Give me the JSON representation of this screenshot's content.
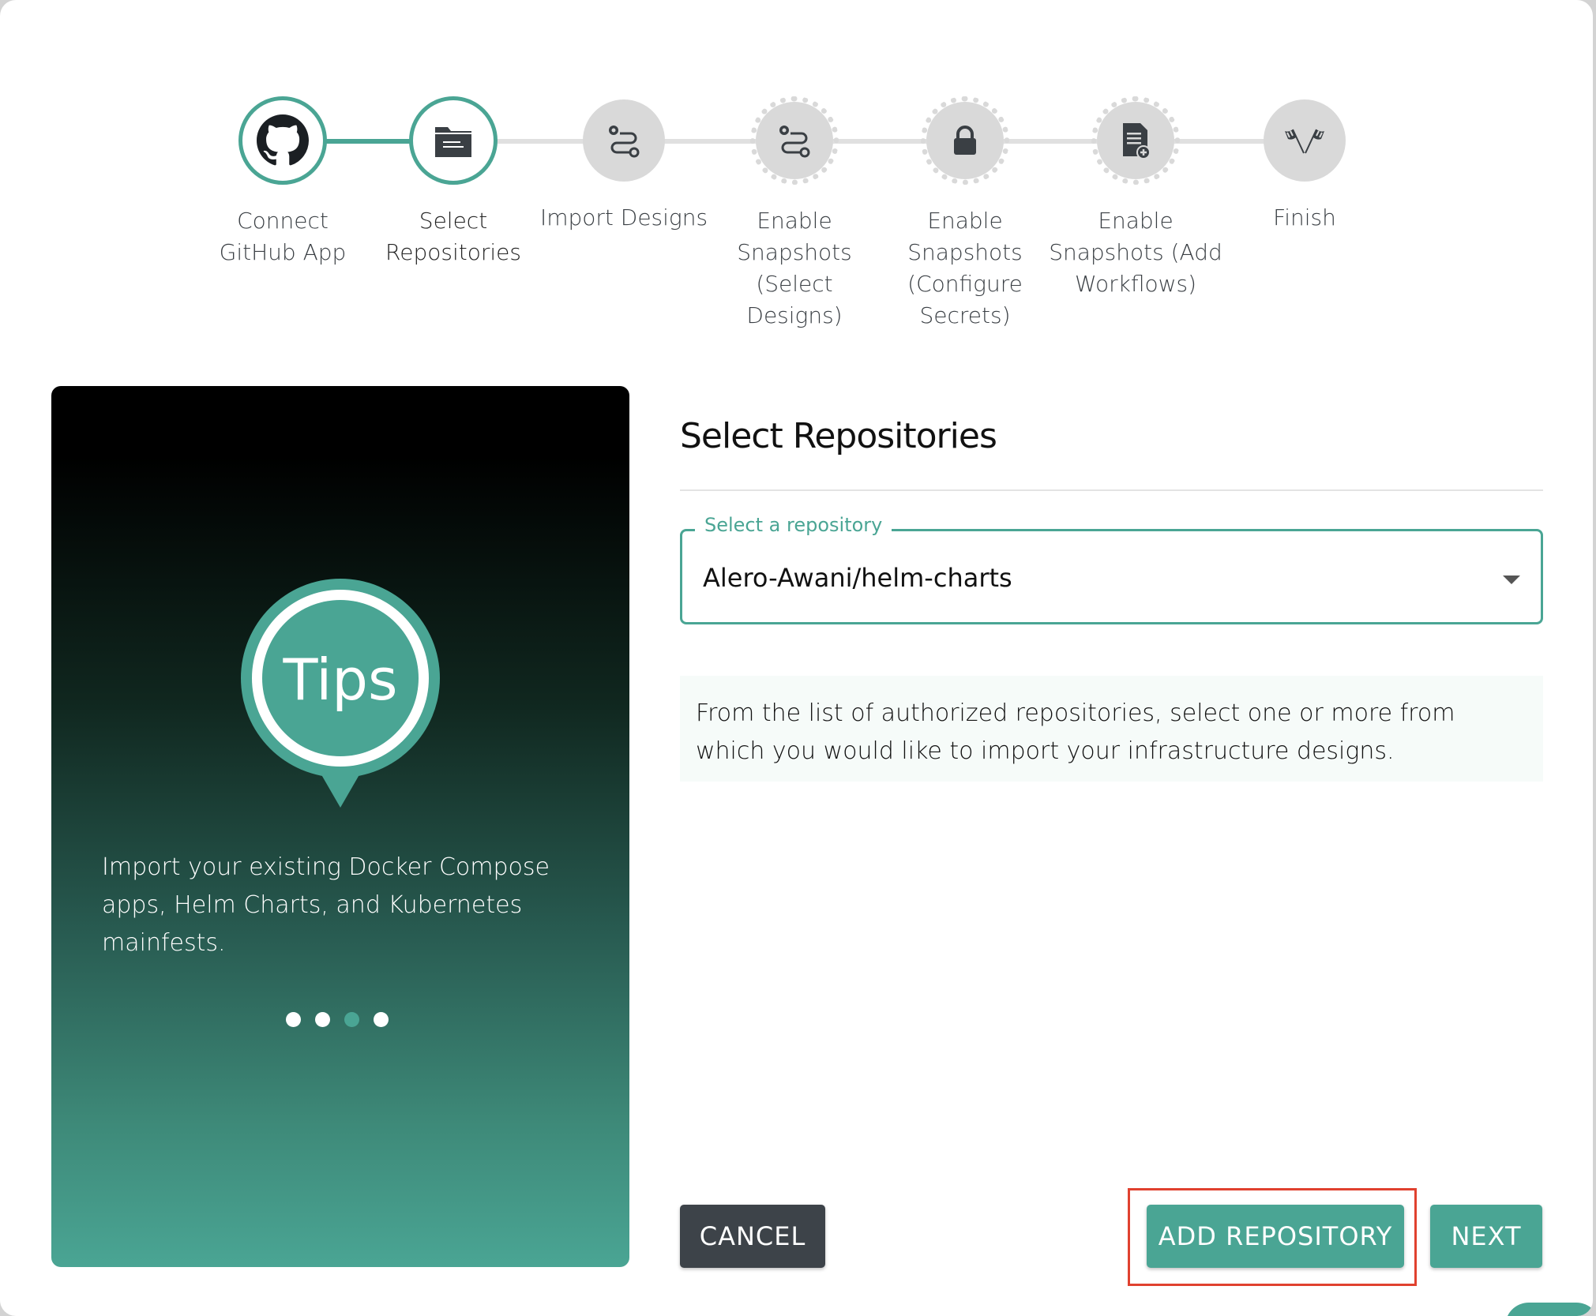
{
  "stepper": {
    "steps": [
      {
        "label": "Connect GitHub App",
        "state": "completed",
        "icon": "github-icon"
      },
      {
        "label": "Select Repositories",
        "state": "active",
        "icon": "folder-icon"
      },
      {
        "label": "Import Designs",
        "state": "pending",
        "icon": "workflow-icon"
      },
      {
        "label": "Enable Snapshots (Select Designs)",
        "state": "pending",
        "icon": "workflow-icon"
      },
      {
        "label": "Enable Snapshots (Configure Secrets)",
        "state": "pending",
        "icon": "lock-icon"
      },
      {
        "label": "Enable Snapshots (Add Workflows)",
        "state": "pending",
        "icon": "document-add-icon"
      },
      {
        "label": "Finish",
        "state": "pending",
        "icon": "checkered-flags-icon"
      }
    ]
  },
  "tips": {
    "badge": "Tips",
    "text": "Import your existing Docker Compose apps, Helm Charts, and Kubernetes mainfests.",
    "carousel_pages": 4,
    "carousel_active_index": 2
  },
  "main": {
    "heading": "Select Repositories",
    "select": {
      "label": "Select a repository",
      "value": "Alero-Awani/helm-charts"
    },
    "info": "From the list of authorized repositories, select one or more from which you would like to import your infrastructure designs."
  },
  "actions": {
    "cancel_label": "CANCEL",
    "add_label": "ADD REPOSITORY",
    "next_label": "NEXT"
  },
  "colors": {
    "accent": "#4aa594",
    "dark_button": "#3d4349",
    "highlight": "#e0412f",
    "pending_step": "#d9d9d9"
  }
}
